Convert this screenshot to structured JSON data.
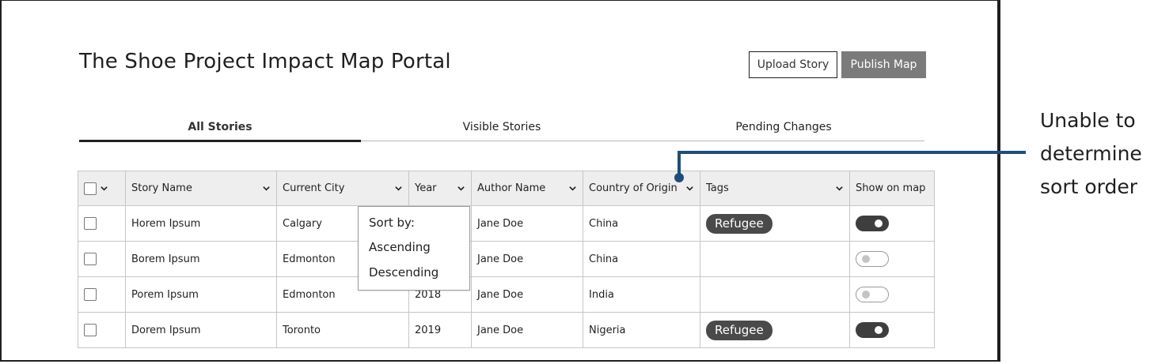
{
  "header": {
    "title": "The Shoe Project Impact Map Portal",
    "upload_label": "Upload Story",
    "publish_label": "Publish Map"
  },
  "tabs": [
    {
      "label": "All Stories",
      "active": true
    },
    {
      "label": "Visible Stories",
      "active": false
    },
    {
      "label": "Pending Changes",
      "active": false
    }
  ],
  "table": {
    "columns": [
      "Story Name",
      "Current City",
      "Year",
      "Author Name",
      "Country of Origin",
      "Tags",
      "Show on map"
    ],
    "rows": [
      {
        "story": "Horem Ipsum",
        "city": "Calgary",
        "year": "",
        "author": "Jane Doe",
        "country": "China",
        "tag": "Refugee",
        "show": true
      },
      {
        "story": "Borem Ipsum",
        "city": "Edmonton",
        "year": "",
        "author": "Jane Doe",
        "country": "China",
        "tag": "",
        "show": false
      },
      {
        "story": "Porem Ipsum",
        "city": "Edmonton",
        "year": "2018",
        "author": "Jane Doe",
        "country": "India",
        "tag": "",
        "show": false
      },
      {
        "story": "Dorem Ipsum",
        "city": "Toronto",
        "year": "2019",
        "author": "Jane Doe",
        "country": "Nigeria",
        "tag": "Refugee",
        "show": true
      }
    ]
  },
  "sort_menu": {
    "label": "Sort by:",
    "ascending": "Ascending",
    "descending": "Descending"
  },
  "annotation": {
    "lines": [
      "Unable to",
      "determine",
      "sort order"
    ]
  },
  "colors": {
    "accent_callout": "#1f4e79",
    "tag_bg": "#4a4a4a",
    "publish_bg": "#7b7b7b"
  }
}
